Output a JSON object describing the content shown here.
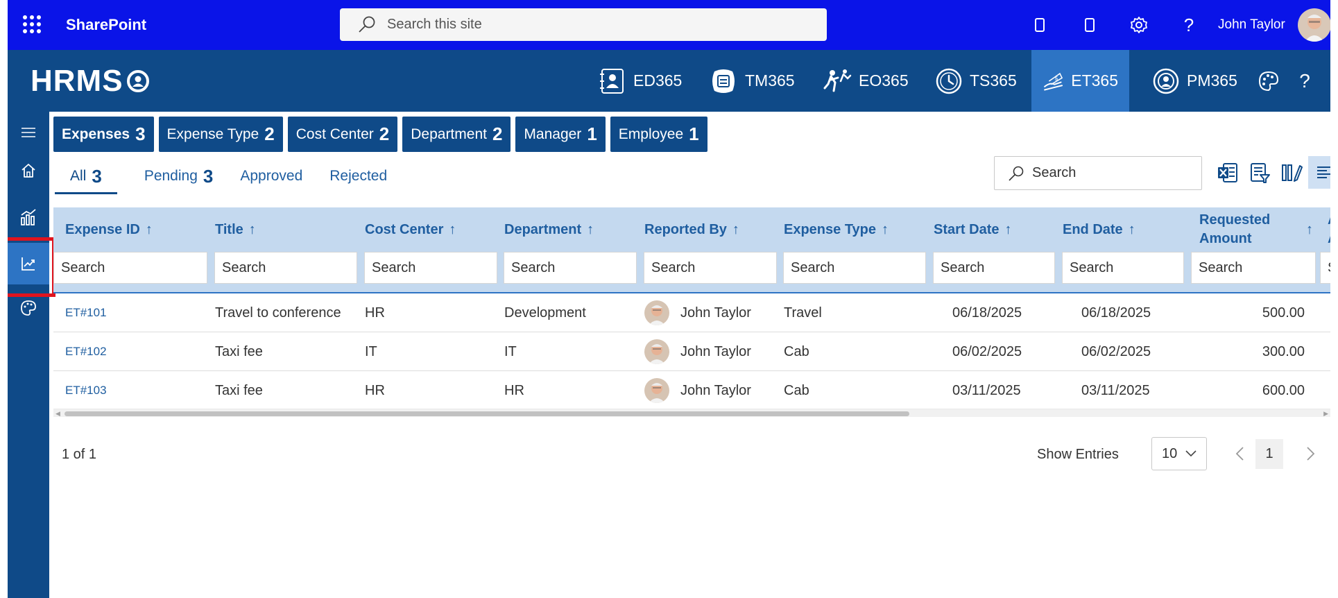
{
  "suitebar": {
    "brand": "SharePoint",
    "search_placeholder": "Search this site",
    "user_name": "John Taylor"
  },
  "header": {
    "logo_text": "HRMS",
    "apps": [
      {
        "label": "ED365",
        "icon": "employee-directory-icon"
      },
      {
        "label": "TM365",
        "icon": "task-management-icon"
      },
      {
        "label": "EO365",
        "icon": "employee-onboarding-icon"
      },
      {
        "label": "TS365",
        "icon": "timesheet-clock-icon"
      },
      {
        "label": "ET365",
        "icon": "expense-tracker-icon",
        "active": true
      },
      {
        "label": "PM365",
        "icon": "performance-management-icon"
      }
    ]
  },
  "sidebar": {
    "items": [
      {
        "name": "hamburger-menu-icon"
      },
      {
        "name": "home-icon"
      },
      {
        "name": "analytics-icon"
      },
      {
        "name": "trend-chart-icon",
        "active": true
      },
      {
        "name": "palette-icon"
      }
    ]
  },
  "category_tabs": [
    {
      "label": "Expenses",
      "count": "3"
    },
    {
      "label": "Expense Type",
      "count": "2"
    },
    {
      "label": "Cost Center",
      "count": "2"
    },
    {
      "label": "Department",
      "count": "2"
    },
    {
      "label": "Manager",
      "count": "1"
    },
    {
      "label": "Employee",
      "count": "1"
    }
  ],
  "status_tabs": [
    {
      "label": "All",
      "count": "3",
      "active": true
    },
    {
      "label": "Pending",
      "count": "3"
    },
    {
      "label": "Approved",
      "count": ""
    },
    {
      "label": "Rejected",
      "count": ""
    }
  ],
  "grid_search_placeholder": "Search",
  "columns": [
    {
      "label": "Expense ID",
      "sort": "↑"
    },
    {
      "label": "Title",
      "sort": "↑"
    },
    {
      "label": "Cost Center",
      "sort": "↑"
    },
    {
      "label": "Department",
      "sort": "↑"
    },
    {
      "label": "Reported By",
      "sort": "↑"
    },
    {
      "label": "Expense Type",
      "sort": "↑"
    },
    {
      "label": "Start Date",
      "sort": "↑"
    },
    {
      "label": "End Date",
      "sort": "↑"
    },
    {
      "label": "Requested Amount",
      "line1": "Requested",
      "line2": "Amount",
      "sort": "↑"
    },
    {
      "label": "A A",
      "line1": "A",
      "line2": "A",
      "sort": ""
    }
  ],
  "filter_placeholder": "Search",
  "rows": [
    {
      "id": "ET#101",
      "title": "Travel to conference",
      "cost_center": "HR",
      "department": "Development",
      "reported_by": "John Taylor",
      "expense_type": "Travel",
      "start": "06/18/2025",
      "end": "06/18/2025",
      "amount": "500.00"
    },
    {
      "id": "ET#102",
      "title": "Taxi fee",
      "cost_center": "IT",
      "department": "IT",
      "reported_by": "John Taylor",
      "expense_type": "Cab",
      "start": "06/02/2025",
      "end": "06/02/2025",
      "amount": "300.00"
    },
    {
      "id": "ET#103",
      "title": "Taxi fee",
      "cost_center": "HR",
      "department": "HR",
      "reported_by": "John Taylor",
      "expense_type": "Cab",
      "start": "03/11/2025",
      "end": "03/11/2025",
      "amount": "600.00"
    }
  ],
  "pagination": {
    "info": "1 of 1",
    "show_entries_label": "Show Entries",
    "entries_value": "10",
    "current_page": "1"
  },
  "colors": {
    "suitebar": "#0a14e8",
    "header": "#0f4a88",
    "active_nav": "#2d74c4",
    "table_header": "#c4d9ef",
    "highlight": "#e0141e"
  }
}
